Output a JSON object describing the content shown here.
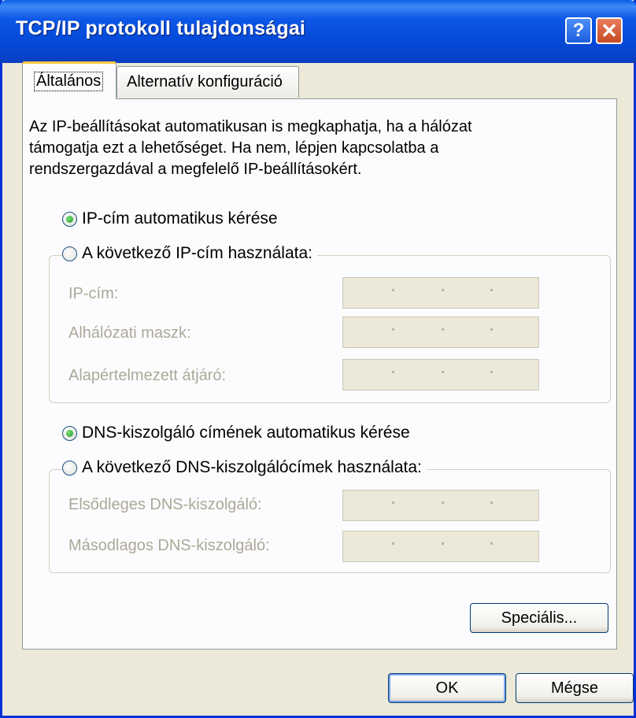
{
  "window": {
    "title": "TCP/IP protokoll tulajdonságai",
    "help_glyph": "?",
    "close_glyph": "✕"
  },
  "tabs": [
    {
      "label": "Általános",
      "active": true
    },
    {
      "label": "Alternatív konfiguráció",
      "active": false
    }
  ],
  "description": [
    "Az IP-beállításokat automatikusan is megkaphatja, ha a hálózat",
    "támogatja ezt a lehetőséget. Ha nem, lépjen kapcsolatba a",
    "rendszergazdával a megfelelő IP-beállításokért."
  ],
  "ip": {
    "auto_label": "IP-cím automatikus kérése",
    "manual_label": "A következő IP-cím használata:",
    "auto_selected": true,
    "fields": [
      {
        "label": "IP-cím:",
        "value": ""
      },
      {
        "label": "Alhálózati maszk:",
        "value": ""
      },
      {
        "label": "Alapértelmezett átjáró:",
        "value": ""
      }
    ]
  },
  "dns": {
    "auto_label": "DNS-kiszolgáló címének automatikus kérése",
    "manual_label": "A következő DNS-kiszolgálócímek használata:",
    "auto_selected": true,
    "fields": [
      {
        "label": "Elsődleges DNS-kiszolgáló:",
        "value": ""
      },
      {
        "label": "Másodlagos DNS-kiszolgáló:",
        "value": ""
      }
    ]
  },
  "buttons": {
    "advanced": "Speciális...",
    "ok": "OK",
    "cancel": "Mégse"
  },
  "colors": {
    "titlebar": "#0a5fe6",
    "dialog_bg": "#ece9d8",
    "panel_bg": "#fcfcfe",
    "disabled_text": "#aca899",
    "tab_highlight": "#ffc83c"
  }
}
